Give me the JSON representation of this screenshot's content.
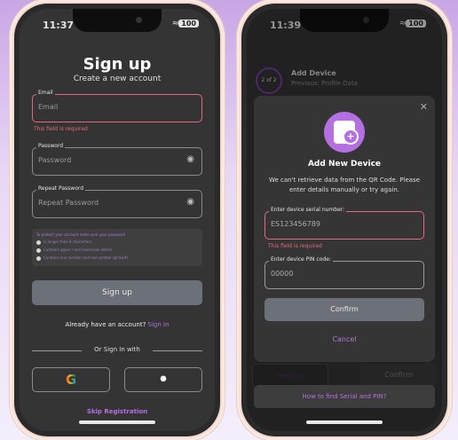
{
  "status": {
    "time_left": "11:37",
    "time_right": "11:39",
    "battery": "100"
  },
  "signup": {
    "title": "Sign up",
    "subtitle": "Create a new account",
    "email": {
      "label": "Email",
      "placeholder": "Email",
      "error": "This field is required"
    },
    "password": {
      "label": "Password",
      "placeholder": "Password"
    },
    "repeat": {
      "label": "Repeat Password",
      "placeholder": "Repeat Password"
    },
    "rules": {
      "title": "To protect your account make sure your password",
      "items": [
        "Is longer than 8 characters",
        "Contains upper / and lowercase letters",
        "Contains one number and one symbol (@!$&#)"
      ]
    },
    "button": "Sign up",
    "already": "Already have an account?",
    "signin_link": "Sign In",
    "or_with": "Or Sign In with",
    "google_glyph": "G",
    "apple_glyph": "",
    "skip": "Skip Registration"
  },
  "device": {
    "step": "2 of 2",
    "heading": "Add Device",
    "previous": "Previous: Profile Data",
    "modal": {
      "title": "Add New Device",
      "desc": "We can't retrieve data from the QR Code. Please enter details manually or try again.",
      "serial": {
        "label": "Enter device serial number:",
        "value": "ES123456789",
        "error": "This field is required"
      },
      "pin": {
        "label": "Enter device PIN code:",
        "value": "00000"
      },
      "confirm": "Confirm",
      "cancel": "Cancel"
    },
    "bg_prev": "Previous",
    "bg_confirm": "Confirm",
    "find": "How to find Serial and PIN?"
  },
  "icons": {
    "close": "close-icon",
    "eye": "eye-off-icon",
    "device": "device-add-icon"
  }
}
